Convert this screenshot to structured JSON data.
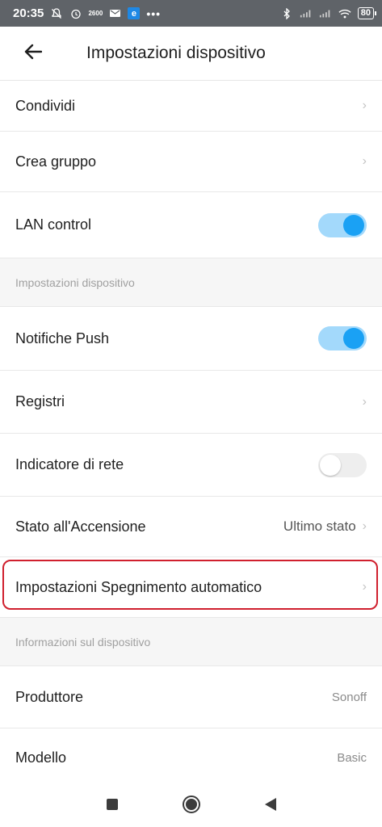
{
  "status_bar": {
    "time": "20:35",
    "data_speed": "2600",
    "notification_letter": "e",
    "more": "•••",
    "battery": "80"
  },
  "header": {
    "title": "Impostazioni dispositivo"
  },
  "rows_top": [
    {
      "label": "Condividi"
    },
    {
      "label": "Crea gruppo"
    },
    {
      "label": "LAN control",
      "toggle": "on"
    }
  ],
  "section_device": "Impostazioni dispositivo",
  "rows_device": [
    {
      "label": "Notifiche Push",
      "toggle": "on"
    },
    {
      "label": "Registri"
    },
    {
      "label": "Indicatore di rete",
      "toggle": "off"
    },
    {
      "label": "Stato all'Accensione",
      "value": "Ultimo stato"
    },
    {
      "label": "Impostazioni Spegnimento automatico"
    }
  ],
  "section_info": "Informazioni sul dispositivo",
  "rows_info": [
    {
      "label": "Produttore",
      "value": "Sonoff"
    },
    {
      "label": "Modello",
      "value": "Basic"
    }
  ],
  "colors": {
    "accent": "#1aa1f4",
    "toggle_track_on": "#a3d9fb",
    "highlight_border": "#d0202e"
  },
  "icons": {
    "back": "arrow-left-icon",
    "chevron": "chevron-right-icon"
  }
}
